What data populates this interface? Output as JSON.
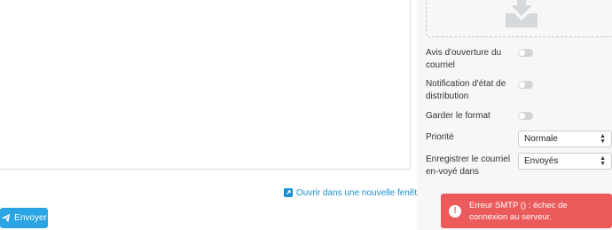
{
  "compose": {
    "send_label": "Envoyer",
    "open_new_window_label": "Ouvrir dans une nouvelle fenêtre"
  },
  "options": {
    "read_receipt_label": "Avis d'ouverture du courriel",
    "dsn_label": "Notification d'état de distribution",
    "keep_format_label": "Garder le format",
    "priority_label": "Priorité",
    "priority_value": "Normale",
    "save_sent_label": "Enregistrer le courriel en-voyé dans",
    "save_sent_value": "Envoyés",
    "read_receipt_on": false,
    "dsn_on": false,
    "keep_format_on": false
  },
  "error": {
    "icon": "exclamation-icon",
    "message": "Erreur SMTP () : échec de connexion au serveur."
  },
  "colors": {
    "accent": "#2aa4e3",
    "link": "#1a8fd0",
    "error": "#ec5b5b"
  }
}
